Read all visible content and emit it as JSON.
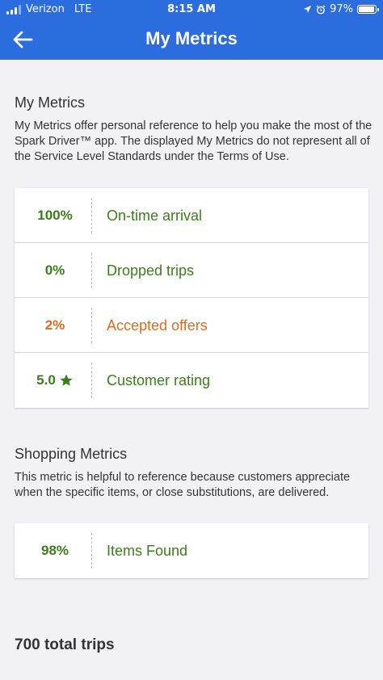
{
  "status_bar": {
    "carrier": "Verizon",
    "network": "LTE",
    "time": "8:15 AM",
    "battery_percent_text": "97%",
    "battery_level": 0.97,
    "icons": [
      "signal-icon",
      "location-arrow-icon",
      "alarm-icon",
      "battery-icon"
    ]
  },
  "header": {
    "title": "My Metrics",
    "back_icon": "back-arrow-icon"
  },
  "colors": {
    "header_bg": "#2b6cdf",
    "good": "#3b7e19",
    "warning": "#e06b1e",
    "background": "#f2f2f4"
  },
  "my_metrics": {
    "title": "My Metrics",
    "description": "My Metrics offer personal reference to help you make the most of the Spark Driver™ app. The displayed My Metrics do not represent all of the Service Level Standards under the Terms of Use.",
    "items": [
      {
        "value": "100%",
        "label": "On-time arrival",
        "status": "good"
      },
      {
        "value": "0%",
        "label": "Dropped trips",
        "status": "good"
      },
      {
        "value": "2%",
        "label": "Accepted offers",
        "status": "warning"
      },
      {
        "value": "5.0",
        "icon": "star-icon",
        "label": "Customer rating",
        "status": "good"
      }
    ]
  },
  "shopping_metrics": {
    "title": "Shopping Metrics",
    "description": "This metric is helpful to reference because customers appreciate when the specific items, or close substitutions, are delivered.",
    "items": [
      {
        "value": "98%",
        "label": "Items Found",
        "status": "good"
      }
    ]
  },
  "footer": {
    "total_trips": "700 total trips"
  }
}
